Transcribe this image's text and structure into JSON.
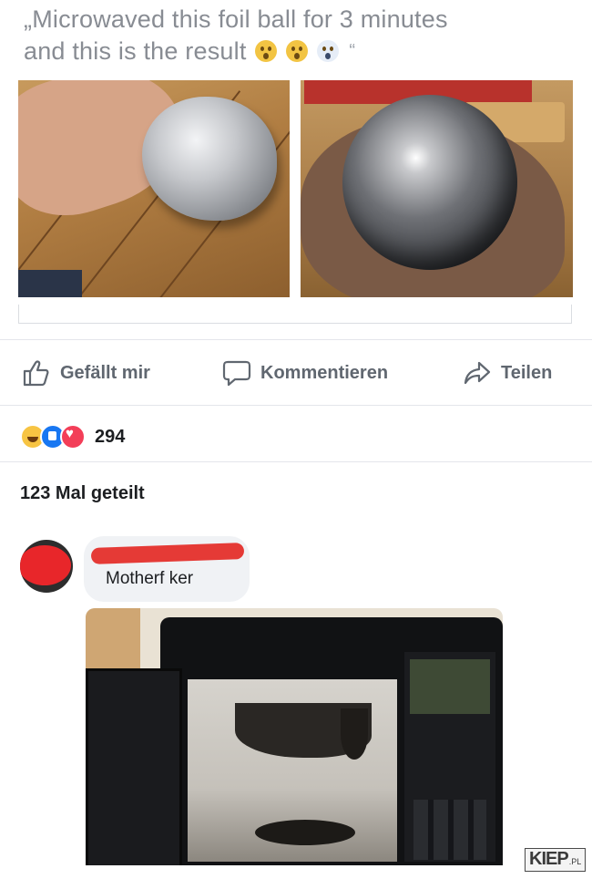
{
  "post": {
    "title_line1": "„Microwaved this foil ball for 3 minutes",
    "title_line2": "and this is the result",
    "title_emojis": [
      "worried-face",
      "astonished-face",
      "screaming-face"
    ],
    "title_close_quote": "“"
  },
  "images": {
    "first": "foil-ball-in-hand",
    "second": "metal-sphere-in-hand",
    "third": "burned-microwave-interior"
  },
  "actions": {
    "like_label": "Gefällt mir",
    "comment_label": "Kommentieren",
    "share_label": "Teilen"
  },
  "reactions": {
    "types": [
      "haha",
      "like",
      "love"
    ],
    "count": "294"
  },
  "shares_text": "123 Mal geteilt",
  "comment": {
    "text": "Motherf   ker"
  },
  "watermark": {
    "main": "KIEP",
    "suffix": ".PL"
  },
  "colors": {
    "title_gray": "#888c93",
    "action_gray": "#606770",
    "like_blue": "#1877f2",
    "love_red": "#f33e58",
    "haha_yellow": "#f7c443",
    "redaction_red": "#e53a36"
  }
}
